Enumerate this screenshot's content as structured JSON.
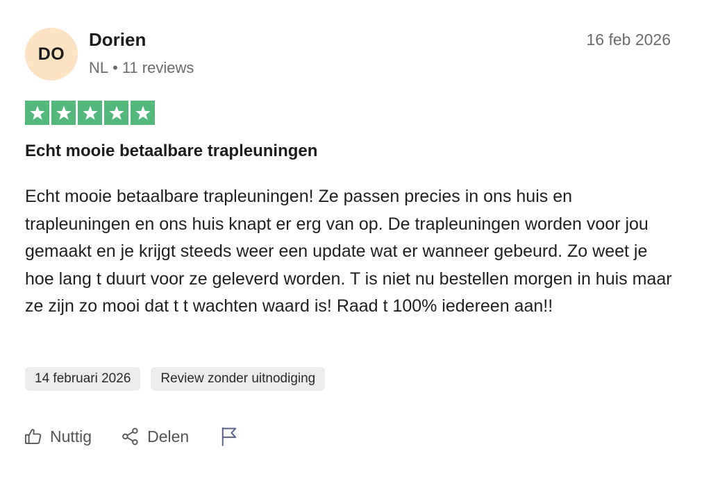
{
  "reviewer": {
    "initials": "DO",
    "name": "Dorien",
    "country": "NL",
    "separator": "•",
    "review_count": "11 reviews",
    "avatar_color": "#fbe3c4"
  },
  "review": {
    "date": "16 feb 2026",
    "rating": 5,
    "max_rating": 5,
    "star_color": "#54b77c",
    "title": "Echt mooie betaalbare trapleuningen",
    "text": "Echt mooie betaalbare trapleuningen! Ze passen precies in ons huis en trapleuningen en ons huis knapt er erg van op. De trapleuningen worden voor jou gemaakt en je krijgt steeds weer een update wat er wanneer gebeurd. Zo weet je hoe lang t duurt voor ze geleverd worden. T is niet nu bestellen morgen in huis maar ze zijn zo mooi dat t t wachten waard is! Raad t 100% iedereen aan!!",
    "tags": [
      "14 februari 2026",
      "Review zonder uitnodiging"
    ]
  },
  "actions": {
    "helpful_label": "Nuttig",
    "helpful_icon": "thumbs-up-icon",
    "share_label": "Delen",
    "share_icon": "share-icon",
    "report_icon": "flag-icon"
  }
}
